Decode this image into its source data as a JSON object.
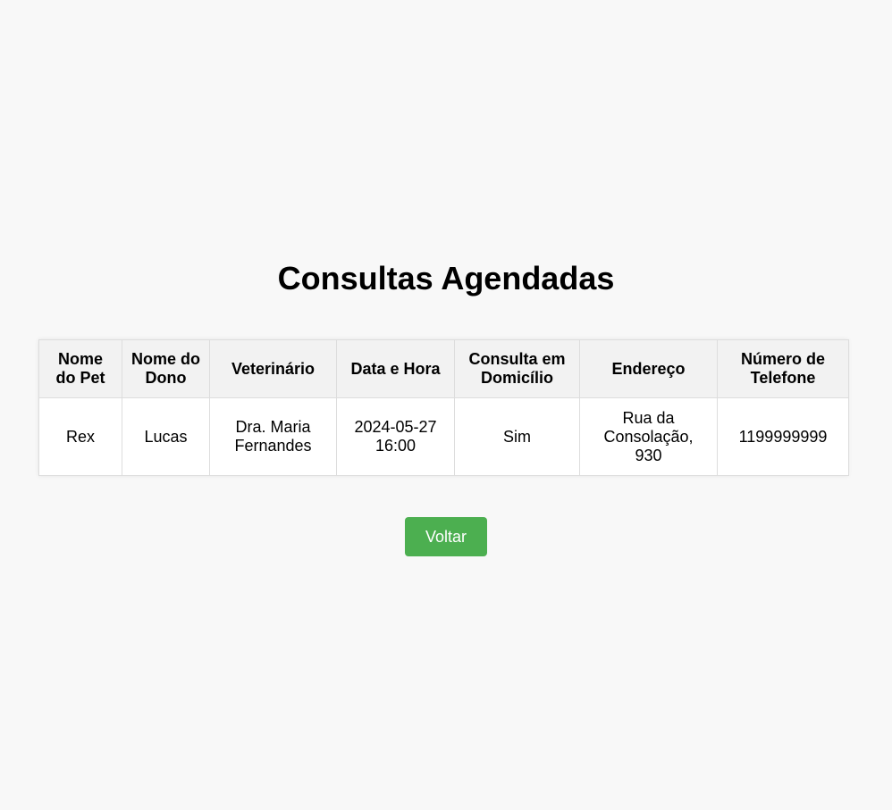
{
  "page": {
    "title": "Consultas Agendadas"
  },
  "table": {
    "headers": [
      "Nome do Pet",
      "Nome do Dono",
      "Veterinário",
      "Data e Hora",
      "Consulta em Domicílio",
      "Endereço",
      "Número de Telefone"
    ],
    "rows": [
      {
        "pet": "Rex",
        "owner": "Lucas",
        "vet": "Dra. Maria Fernandes",
        "datetime": "2024-05-27 16:00",
        "home_visit": "Sim",
        "address": "Rua da Consolação, 930",
        "phone": "1199999999"
      }
    ]
  },
  "actions": {
    "back_label": "Voltar"
  },
  "colors": {
    "background": "#f8f8f8",
    "header_bg": "#f2f2f2",
    "button_bg": "#4caf50",
    "button_text": "#ffffff",
    "border": "#dddddd"
  }
}
